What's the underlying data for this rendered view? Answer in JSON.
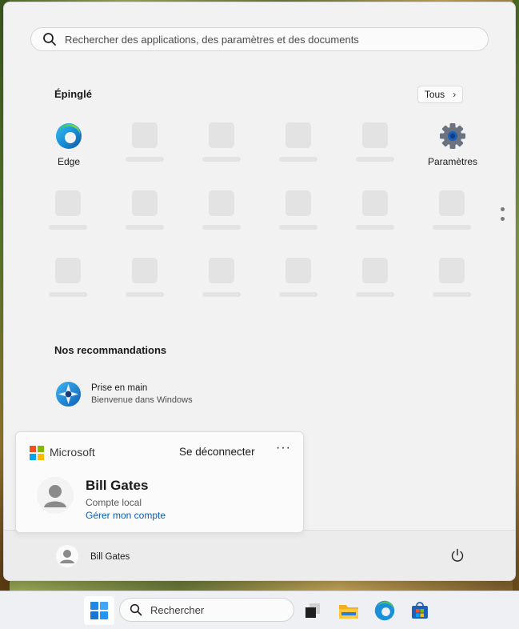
{
  "search": {
    "placeholder": "Rechercher des applications, des paramètres et des documents"
  },
  "pinned": {
    "title": "Épinglé",
    "all_button": "Tous",
    "apps": [
      {
        "label": "Edge",
        "icon": "edge-icon"
      },
      {
        "label": "Paramètres",
        "icon": "settings-gear-icon"
      }
    ]
  },
  "recommendations": {
    "title": "Nos recommandations",
    "items": [
      {
        "title": "Prise en main",
        "subtitle": "Bienvenue dans Windows",
        "icon": "get-started-icon"
      }
    ]
  },
  "account_card": {
    "brand": "Microsoft",
    "sign_out": "Se déconnecter",
    "more": "···",
    "user_name": "Bill Gates",
    "account_type": "Compte local",
    "manage_link": "Gérer mon compte"
  },
  "footer": {
    "user_name": "Bill Gates",
    "power_icon": "power-icon"
  },
  "taskbar": {
    "search_placeholder": "Rechercher",
    "apps": [
      "start-icon",
      "task-view-icon",
      "file-explorer-icon",
      "edge-icon",
      "microsoft-store-icon"
    ]
  },
  "colors": {
    "accent": "#0b5cad",
    "menu_bg": "#f2f2f2",
    "taskbar_bg": "#eef0f3"
  }
}
